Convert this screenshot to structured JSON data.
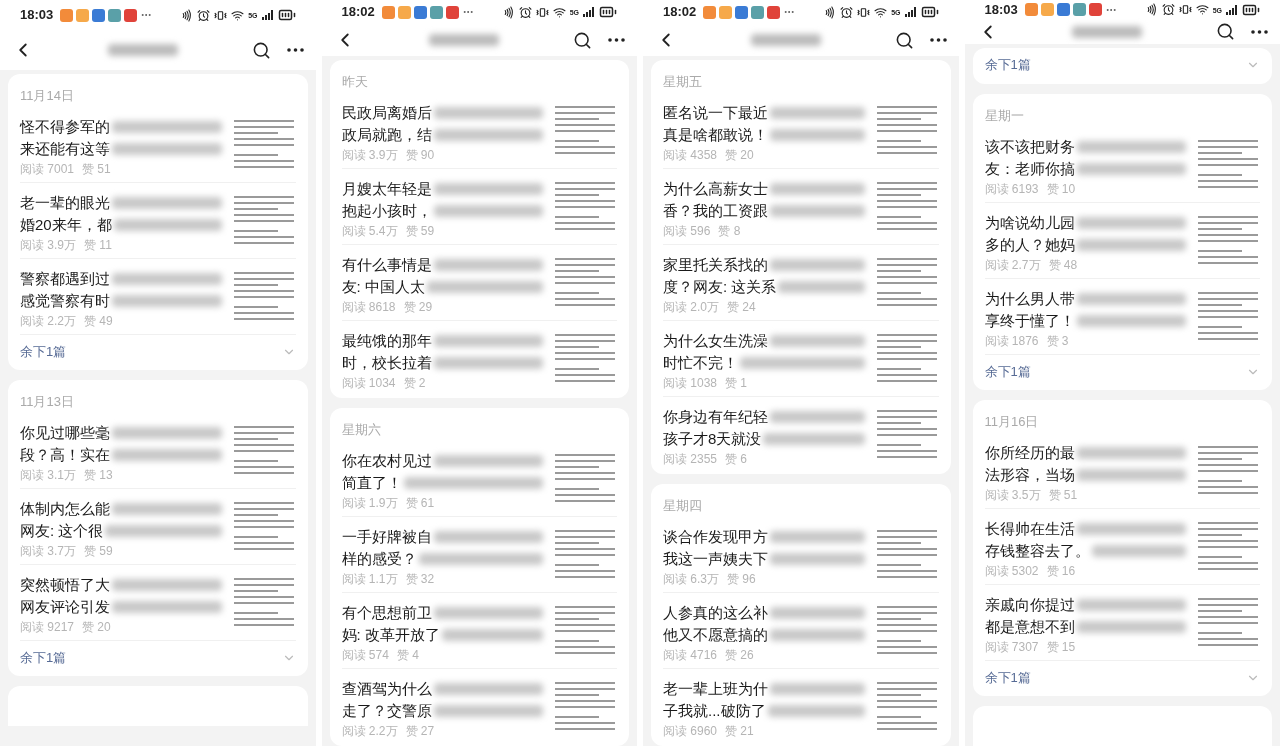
{
  "panels": [
    {
      "status": {
        "time": "18:03",
        "network": "5G"
      },
      "groups": [
        {
          "kind": "article_group",
          "heading": "11月14日",
          "articles": [
            {
              "title_lines": [
                "怪不得参军的",
                "来还能有这等"
              ],
              "reads": "阅读 7001",
              "likes": "赞 51"
            },
            {
              "title_lines": [
                "老一辈的眼光",
                "婚20来年，都"
              ],
              "reads": "阅读 3.9万",
              "likes": "赞 11"
            },
            {
              "title_lines": [
                "警察都遇到过",
                "感觉警察有时"
              ],
              "reads": "阅读 2.2万",
              "likes": "赞 49"
            }
          ],
          "more_label": "余下1篇"
        },
        {
          "kind": "article_group",
          "heading": "11月13日",
          "articles": [
            {
              "title_lines": [
                "你见过哪些毫",
                "段？高！实在"
              ],
              "reads": "阅读 3.1万",
              "likes": "赞 13"
            },
            {
              "title_lines": [
                "体制内怎么能",
                "网友: 这个很"
              ],
              "reads": "阅读 3.7万",
              "likes": "赞 59"
            },
            {
              "title_lines": [
                "突然顿悟了大",
                "网友评论引发"
              ],
              "reads": "阅读 9217",
              "likes": "赞 20"
            }
          ],
          "more_label": "余下1篇"
        },
        {
          "kind": "cut_off_card"
        }
      ]
    },
    {
      "status": {
        "time": "18:02",
        "network": "5G"
      },
      "groups": [
        {
          "kind": "article_group",
          "heading": "昨天",
          "articles": [
            {
              "title_lines": [
                "民政局离婚后",
                "政局就跑，结"
              ],
              "reads": "阅读 3.9万",
              "likes": "赞 90"
            },
            {
              "title_lines": [
                "月嫂太年轻是",
                "抱起小孩时，"
              ],
              "reads": "阅读 5.4万",
              "likes": "赞 59"
            },
            {
              "title_lines": [
                "有什么事情是",
                "友: 中国人太"
              ],
              "reads": "阅读 8618",
              "likes": "赞 29"
            },
            {
              "title_lines": [
                "最纯饿的那年",
                "时，校长拉着"
              ],
              "reads": "阅读 1034",
              "likes": "赞 2"
            }
          ]
        },
        {
          "kind": "article_group",
          "heading": "星期六",
          "articles": [
            {
              "title_lines": [
                "你在农村见过",
                "简直了！"
              ],
              "reads": "阅读 1.9万",
              "likes": "赞 61"
            },
            {
              "title_lines": [
                "一手好牌被自",
                "样的感受？"
              ],
              "reads": "阅读 1.1万",
              "likes": "赞 32"
            },
            {
              "title_lines": [
                "有个思想前卫",
                "妈: 改革开放了"
              ],
              "reads": "阅读 574",
              "likes": "赞 4"
            },
            {
              "title_lines": [
                "查酒驾为什么",
                "走了？交警原"
              ],
              "reads": "阅读 2.2万",
              "likes": "赞 27"
            }
          ]
        }
      ]
    },
    {
      "status": {
        "time": "18:02",
        "network": "5G"
      },
      "groups": [
        {
          "kind": "article_group",
          "heading": "星期五",
          "articles": [
            {
              "title_lines": [
                "匿名说一下最近",
                "真是啥都敢说！"
              ],
              "reads": "阅读 4358",
              "likes": "赞 20"
            },
            {
              "title_lines": [
                "为什么高薪女士",
                "香？我的工资跟"
              ],
              "reads": "阅读 596",
              "likes": "赞 8"
            },
            {
              "title_lines": [
                "家里托关系找的",
                "度？网友: 这关系"
              ],
              "reads": "阅读 2.0万",
              "likes": "赞 24"
            },
            {
              "title_lines": [
                "为什么女生洗澡",
                "时忙不完！"
              ],
              "reads": "阅读 1038",
              "likes": "赞 1"
            },
            {
              "title_lines": [
                "你身边有年纪轻",
                "孩子才8天就没"
              ],
              "reads": "阅读 2355",
              "likes": "赞 6"
            }
          ]
        },
        {
          "kind": "article_group",
          "heading": "星期四",
          "articles": [
            {
              "title_lines": [
                "谈合作发现甲方",
                "我这一声姨夫下"
              ],
              "reads": "阅读 6.3万",
              "likes": "赞 96"
            },
            {
              "title_lines": [
                "人参真的这么补",
                "他又不愿意搞的"
              ],
              "reads": "阅读 4716",
              "likes": "赞 26"
            },
            {
              "title_lines": [
                "老一辈上班为什",
                "子我就...破防了"
              ],
              "reads": "阅读 6960",
              "likes": "赞 21"
            }
          ]
        }
      ]
    },
    {
      "status": {
        "time": "18:03",
        "network": "5G"
      },
      "groups": [
        {
          "kind": "article_group",
          "more_label": "余下1篇"
        },
        {
          "kind": "article_group",
          "heading": "星期一",
          "articles": [
            {
              "title_lines": [
                "该不该把财务",
                "友：老师你搞"
              ],
              "reads": "阅读 6193",
              "likes": "赞 10"
            },
            {
              "title_lines": [
                "为啥说幼儿园",
                "多的人？她妈"
              ],
              "reads": "阅读 2.7万",
              "likes": "赞 48"
            },
            {
              "title_lines": [
                "为什么男人带",
                "享终于懂了！"
              ],
              "reads": "阅读 1876",
              "likes": "赞 3"
            }
          ],
          "more_label": "余下1篇"
        },
        {
          "kind": "article_group",
          "heading": "11月16日",
          "articles": [
            {
              "title_lines": [
                "你所经历的最",
                "法形容，当场"
              ],
              "reads": "阅读 3.5万",
              "likes": "赞 51"
            },
            {
              "title_lines": [
                "长得帅在生活",
                "存钱整容去了。"
              ],
              "reads": "阅读 5302",
              "likes": "赞 16"
            },
            {
              "title_lines": [
                "亲戚向你提过",
                "都是意想不到"
              ],
              "reads": "阅读 7307",
              "likes": "赞 15"
            }
          ],
          "more_label": "余下1篇"
        },
        {
          "kind": "cut_off_card"
        }
      ]
    }
  ]
}
